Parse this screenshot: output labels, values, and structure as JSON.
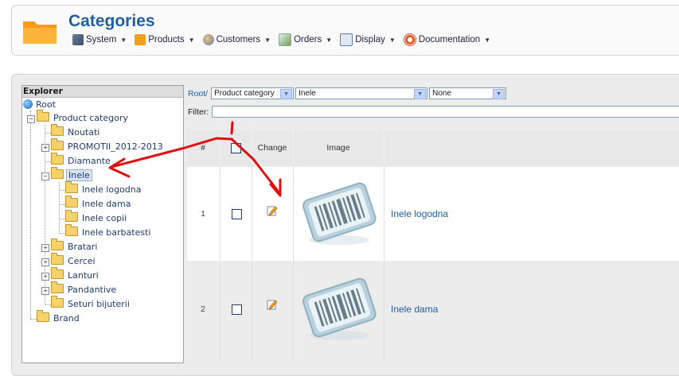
{
  "header": {
    "title": "Categories",
    "menu": [
      {
        "label": "System",
        "icon": "wrench-icon"
      },
      {
        "label": "Products",
        "icon": "box-icon"
      },
      {
        "label": "Customers",
        "icon": "users-icon"
      },
      {
        "label": "Orders",
        "icon": "orders-icon"
      },
      {
        "label": "Display",
        "icon": "display-icon"
      },
      {
        "label": "Documentation",
        "icon": "lifebuoy-icon"
      }
    ]
  },
  "explorer": {
    "title": "Explorer",
    "root": "Root",
    "tree": [
      {
        "label": "Product category"
      },
      {
        "label": "Noutati"
      },
      {
        "label": "PROMOTII_2012-2013"
      },
      {
        "label": "Diamante"
      },
      {
        "label": "Inele",
        "selected": true
      },
      {
        "label": "Inele logodna"
      },
      {
        "label": "Inele dama"
      },
      {
        "label": "Inele copii"
      },
      {
        "label": "Inele barbatesti"
      },
      {
        "label": "Bratari"
      },
      {
        "label": "Cercei"
      },
      {
        "label": "Lanturi"
      },
      {
        "label": "Pandantive"
      },
      {
        "label": "Seturi bijuterii"
      },
      {
        "label": "Brand"
      }
    ]
  },
  "breadcrumb": {
    "root": "Root/",
    "select1": "Product category",
    "select2": "Inele",
    "select3": "None"
  },
  "filter": {
    "label": "Filter:",
    "value": ""
  },
  "grid": {
    "columns": {
      "num": "#",
      "change": "Change",
      "image": "Image"
    },
    "rows": [
      {
        "num": "1",
        "name": "Inele logodna"
      },
      {
        "num": "2",
        "name": "Inele dama"
      }
    ]
  },
  "colors": {
    "accent": "#1f5fa0",
    "annotation": "#e01010"
  }
}
